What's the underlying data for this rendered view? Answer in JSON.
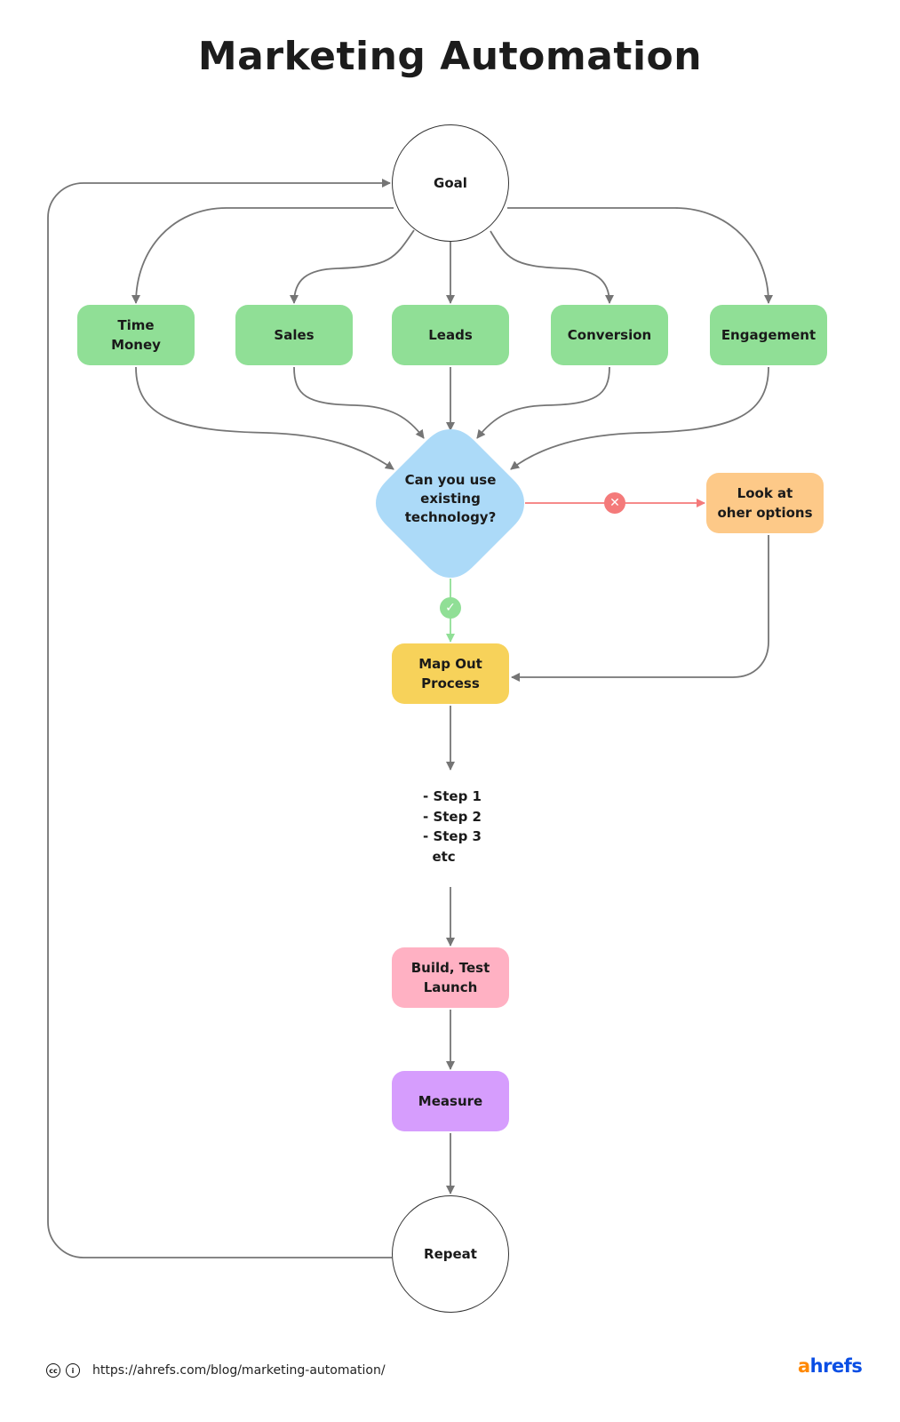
{
  "title": "Marketing Automation",
  "nodes": {
    "goal": "Goal",
    "time_money": "Time\nMoney",
    "sales": "Sales",
    "leads": "Leads",
    "conversion": "Conversion",
    "engagement": "Engagement",
    "decision": "Can you use\nexisting\ntechnology?",
    "look_at_options": "Look at\noher options",
    "map_out": "Map Out\nProcess",
    "steps": "- Step 1\n- Step 2\n- Step 3\n  etc",
    "build_test": "Build, Test\nLaunch",
    "measure": "Measure",
    "repeat": "Repeat"
  },
  "decision_outcomes": {
    "no_symbol": "✕",
    "yes_symbol": "✓"
  },
  "colors": {
    "goal_category": "#90df96",
    "decision": "#acdaf8",
    "alternative": "#fdc988",
    "map_out": "#f7d25a",
    "build": "#ffb1c3",
    "measure": "#d69dfd",
    "no_path": "#f47a7a",
    "yes_path": "#90df96",
    "connector": "#757575"
  },
  "footer": {
    "license_icons": [
      "cc-icon",
      "attribution-icon"
    ],
    "url": "https://ahrefs.com/blog/marketing-automation/",
    "logo_a": "a",
    "logo_rest": "hrefs"
  }
}
